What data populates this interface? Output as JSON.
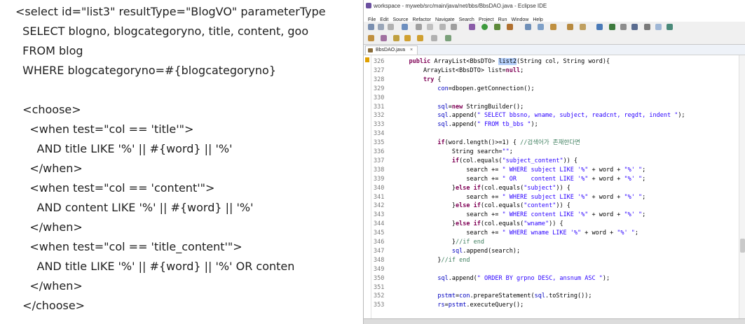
{
  "slide": {
    "lines": [
      "<select id=\"list3\" resultType=\"BlogVO\" parameterType",
      "  SELECT blogno, blogcategoryno, title, content, goo",
      "  FROM blog",
      "  WHERE blogcategoryno=#{blogcategoryno}",
      "",
      "  <choose>",
      "    <when test=\"col == 'title'\">",
      "      AND title LIKE '%' || #{word} || '%'",
      "    </when>",
      "    <when test=\"col == 'content'\">",
      "      AND content LIKE '%' || #{word} || '%'",
      "    </when>",
      "    <when test=\"col == 'title_content'\">",
      "      AND title LIKE '%' || #{word} || '%' OR conten",
      "    </when>",
      "  </choose>"
    ]
  },
  "ide": {
    "window_title": "workspace - myweb/src/main/java/net/bbs/BbsDAO.java - Eclipse IDE",
    "menu": [
      "File",
      "Edit",
      "Source",
      "Refactor",
      "Navigate",
      "Search",
      "Project",
      "Run",
      "Window",
      "Help"
    ],
    "tab_label": "BbsDAO.java",
    "tab_close": "×",
    "code_lines": [
      {
        "n": "326",
        "t": "    public ArrayList<BbsDTO> list2(String col, String word){"
      },
      {
        "n": "327",
        "t": "        ArrayList<BbsDTO> list=null;"
      },
      {
        "n": "328",
        "t": "        try {"
      },
      {
        "n": "329",
        "t": "            con=dbopen.getConnection();"
      },
      {
        "n": "330",
        "t": ""
      },
      {
        "n": "331",
        "t": "            sql=new StringBuilder();"
      },
      {
        "n": "332",
        "t": "            sql.append(\" SELECT bbsno, wname, subject, readcnt, regdt, indent \");"
      },
      {
        "n": "333",
        "t": "            sql.append(\" FROM tb_bbs \");"
      },
      {
        "n": "334",
        "t": ""
      },
      {
        "n": "335",
        "t": "            if(word.length()>=1) { //검색어가 존재한다면"
      },
      {
        "n": "336",
        "t": "                String search=\"\";"
      },
      {
        "n": "337",
        "t": "                if(col.equals(\"subject_content\")) {"
      },
      {
        "n": "338",
        "t": "                    search += \" WHERE subject LIKE '%\" + word + \"%' \";"
      },
      {
        "n": "339",
        "t": "                    search += \" OR    content LIKE '%\" + word + \"%' \";"
      },
      {
        "n": "340",
        "t": "                }else if(col.equals(\"subject\")) {"
      },
      {
        "n": "341",
        "t": "                    search += \" WHERE subject LIKE '%\" + word + \"%' \";"
      },
      {
        "n": "342",
        "t": "                }else if(col.equals(\"content\")) {"
      },
      {
        "n": "343",
        "t": "                    search += \" WHERE content LIKE '%\" + word + \"%' \";"
      },
      {
        "n": "344",
        "t": "                }else if(col.equals(\"wname\")) {"
      },
      {
        "n": "345",
        "t": "                    search += \" WHERE wname LIKE '%\" + word + \"%' \";"
      },
      {
        "n": "346",
        "t": "                }//if end"
      },
      {
        "n": "347",
        "t": "                sql.append(search);"
      },
      {
        "n": "348",
        "t": "            }//if end"
      },
      {
        "n": "349",
        "t": ""
      },
      {
        "n": "350",
        "t": "            sql.append(\" ORDER BY grpno DESC, ansnum ASC \");"
      },
      {
        "n": "351",
        "t": ""
      },
      {
        "n": "352",
        "t": "            pstmt=con.prepareStatement(sql.toString());"
      },
      {
        "n": "353",
        "t": "            rs=pstmt.executeQuery();"
      }
    ]
  }
}
